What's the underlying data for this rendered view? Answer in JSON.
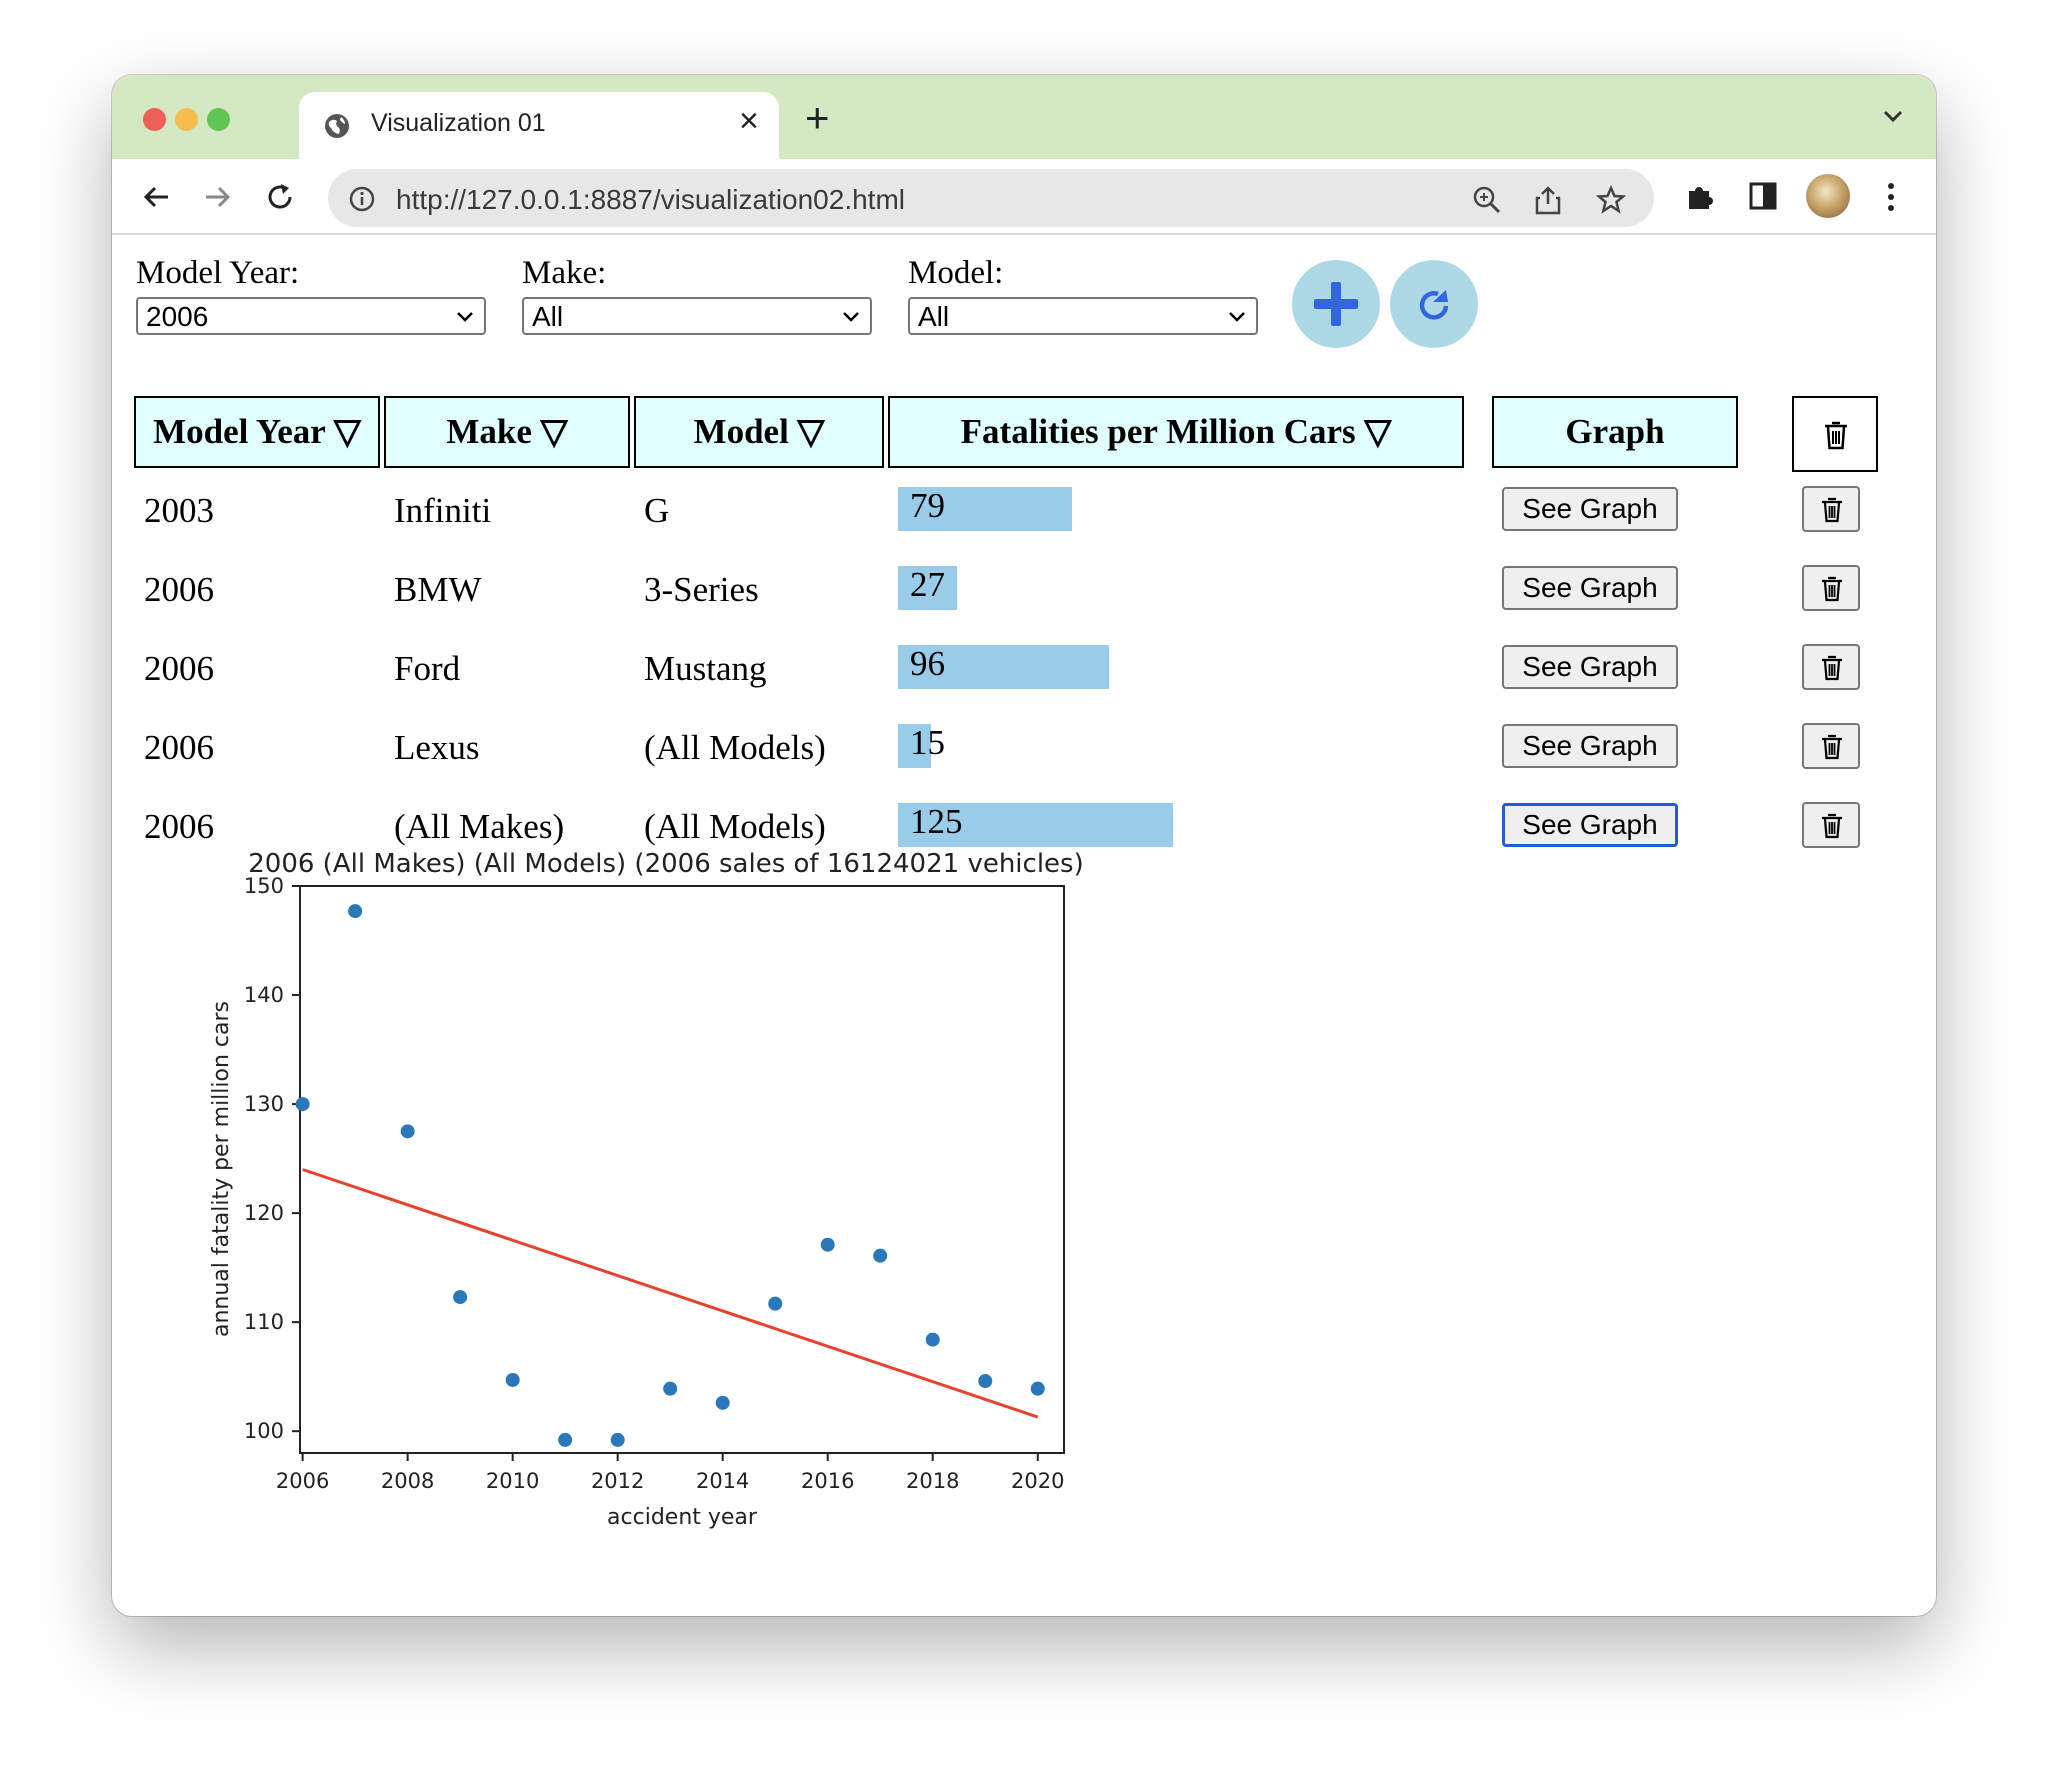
{
  "browser": {
    "tab_title": "Visualization 01",
    "url": "http://127.0.0.1:8887/visualization02.html",
    "new_tab": "+",
    "tab_close": "×"
  },
  "filters": {
    "model_year": {
      "label": "Model Year:",
      "value": "2006"
    },
    "make": {
      "label": "Make:",
      "value": "All"
    },
    "model": {
      "label": "Model:",
      "value": "All"
    }
  },
  "table": {
    "headers": [
      "Model Year ▽",
      "Make ▽",
      "Model ▽",
      "Fatalities per Million Cars ▽",
      "Graph"
    ],
    "rows": [
      {
        "year": "2003",
        "make": "Infiniti",
        "model": "G",
        "fatalities": 79,
        "fatalities_label": "79",
        "graph_label": "See Graph"
      },
      {
        "year": "2006",
        "make": "BMW",
        "model": "3-Series",
        "fatalities": 27,
        "fatalities_label": "27",
        "graph_label": "See Graph"
      },
      {
        "year": "2006",
        "make": "Ford",
        "model": "Mustang",
        "fatalities": 96,
        "fatalities_label": "96",
        "graph_label": "See Graph"
      },
      {
        "year": "2006",
        "make": "Lexus",
        "model": "(All Models)",
        "fatalities": 15,
        "fatalities_label": "15",
        "graph_label": "See Graph"
      },
      {
        "year": "2006",
        "make": "(All Makes)",
        "model": "(All Models)",
        "fatalities": 125,
        "fatalities_label": "125",
        "graph_label": "See Graph"
      }
    ]
  },
  "chart_data": {
    "type": "scatter",
    "title": "2006 (All Makes) (All Models) (2006 sales of 16124021 vehicles)",
    "xlabel": "accident year",
    "ylabel": "annual fatality per million cars",
    "xlim": [
      2005.95,
      2020.5
    ],
    "ylim": [
      98,
      150
    ],
    "xticks": [
      2006,
      2008,
      2010,
      2012,
      2014,
      2016,
      2018,
      2020
    ],
    "xtick_labels": [
      "2006",
      "2008",
      "2010",
      "2012",
      "2014",
      "2016",
      "2018",
      "2020"
    ],
    "yticks": [
      100,
      110,
      120,
      130,
      140,
      150
    ],
    "ytick_labels": [
      "100",
      "110",
      "120",
      "130",
      "140",
      "150"
    ],
    "grid": false,
    "series": [
      {
        "x": [
          2006,
          2007,
          2008,
          2009,
          2010,
          2011,
          2012,
          2013,
          2014,
          2015,
          2016,
          2017,
          2018,
          2019,
          2020
        ],
        "y": [
          130.0,
          147.7,
          127.5,
          112.3,
          104.7,
          99.2,
          99.2,
          103.9,
          102.6,
          111.7,
          117.1,
          116.1,
          108.4,
          104.6,
          103.9
        ],
        "color": "#2a78b9"
      }
    ],
    "trendline": {
      "x": [
        2006,
        2020
      ],
      "y": [
        124.0,
        101.3
      ],
      "color": "#e8412c"
    }
  },
  "colors": {
    "bar": "#99cce8",
    "header_bg": "#e0ffff",
    "circle_button": "#add8e6",
    "plus": "#3366dd"
  }
}
